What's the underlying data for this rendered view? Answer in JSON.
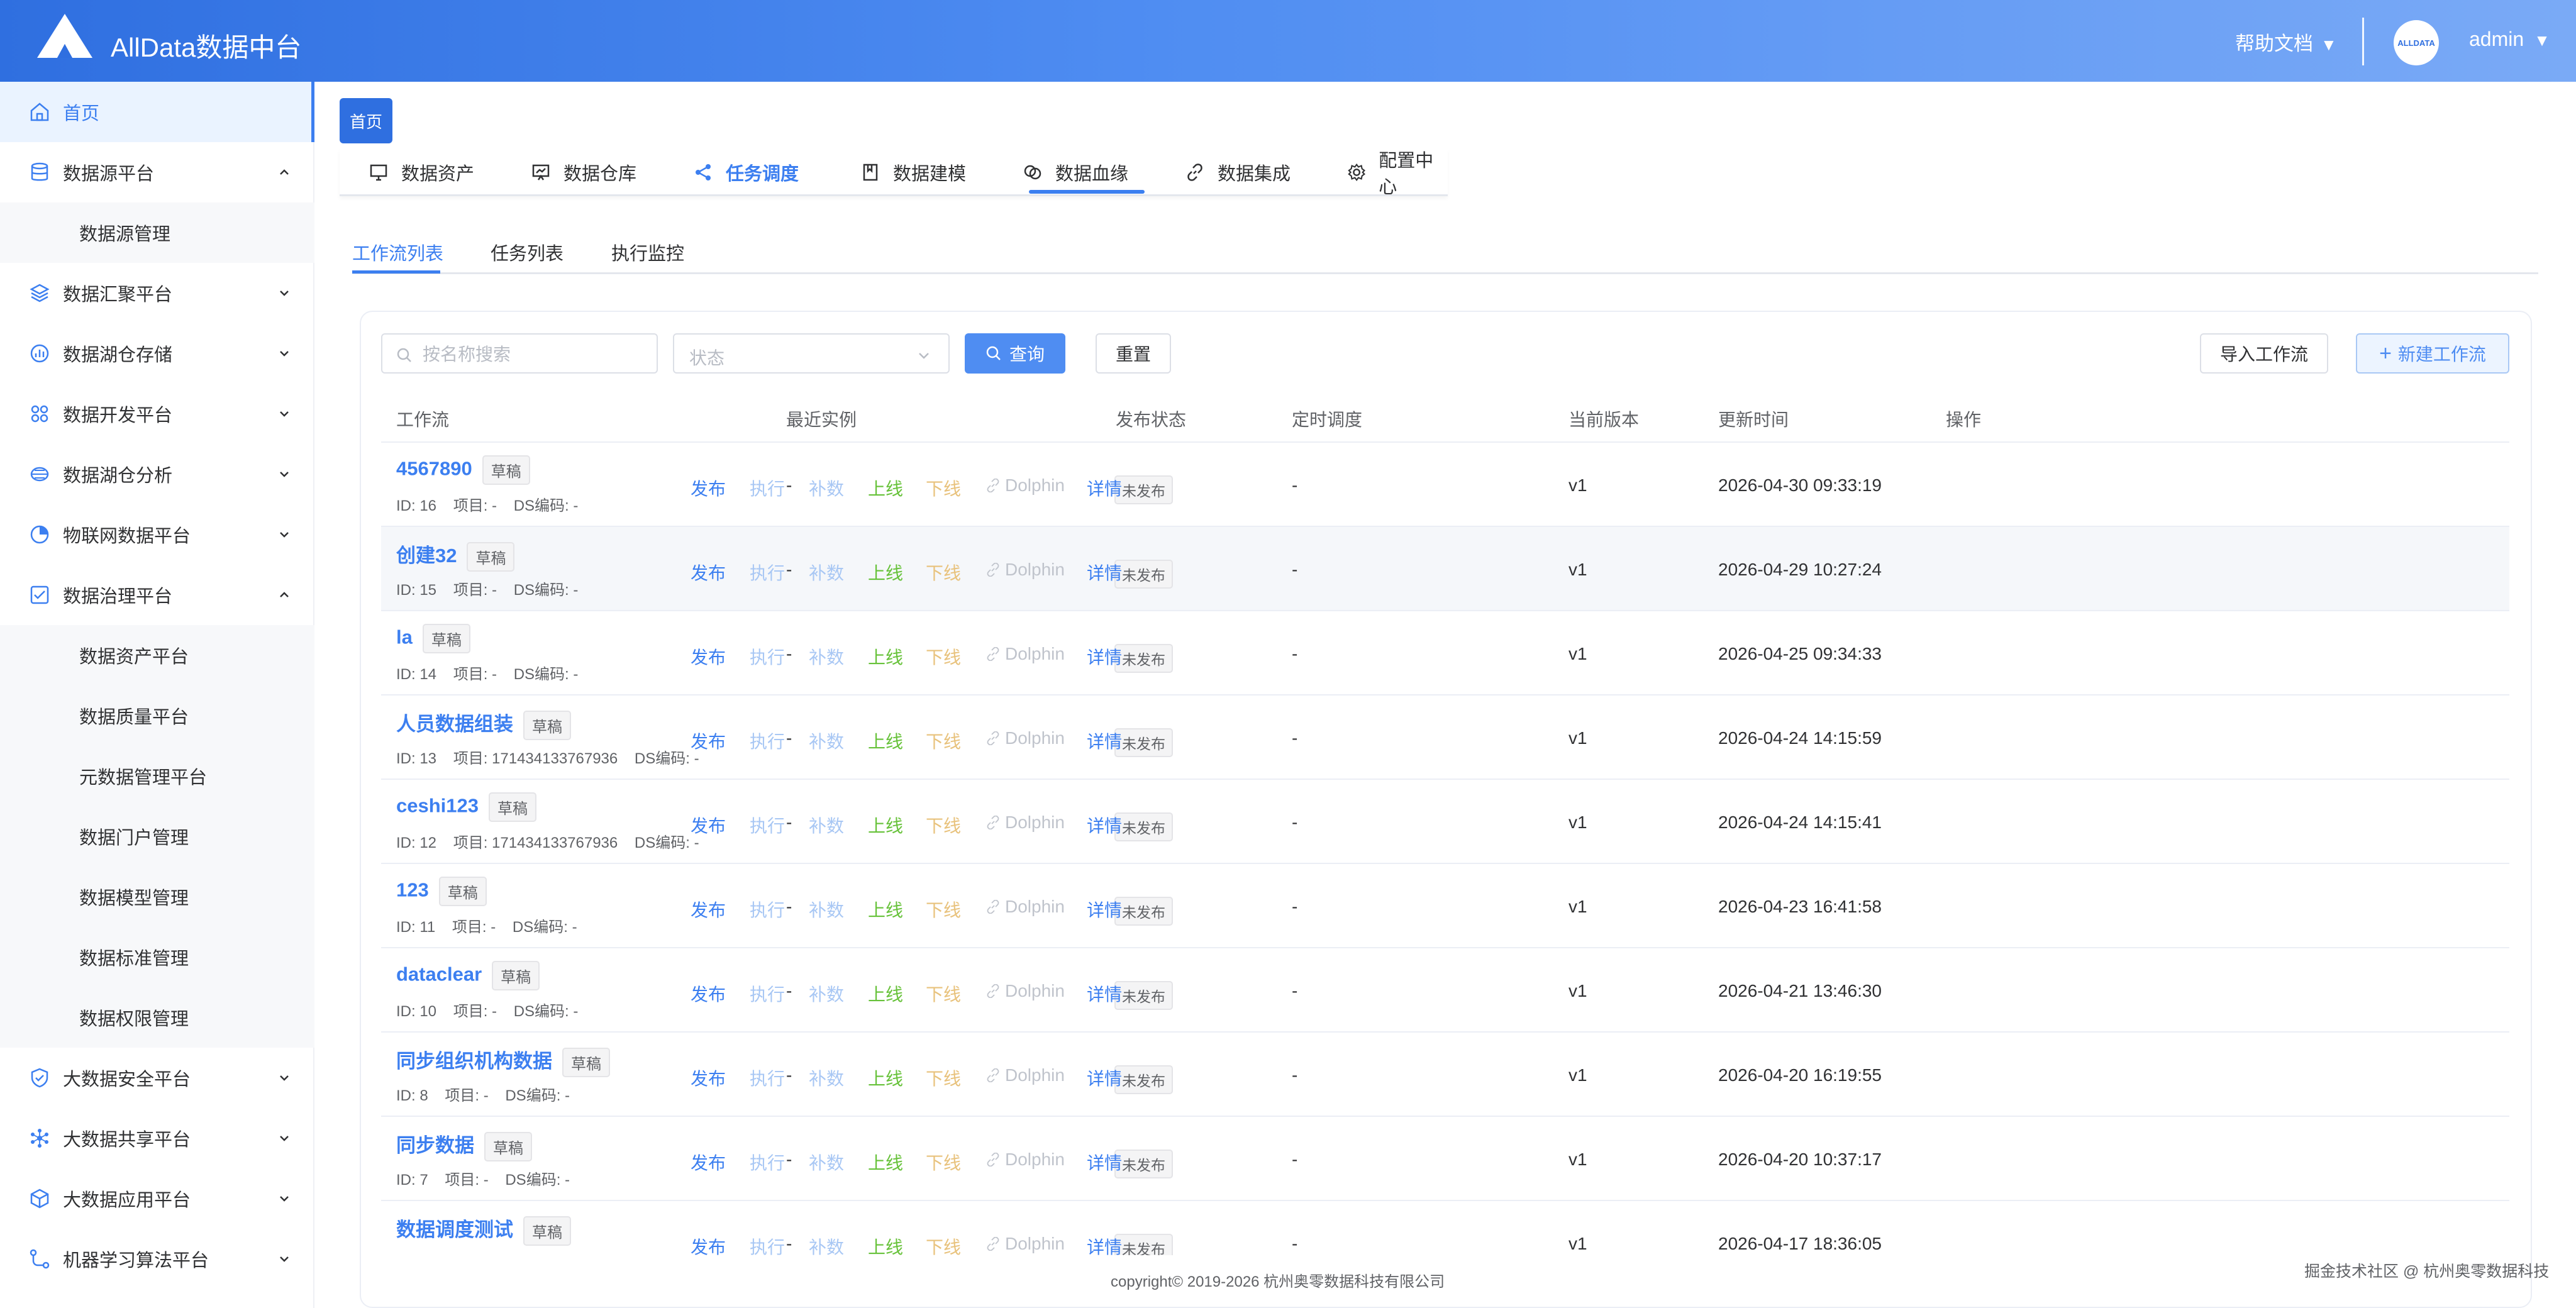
{
  "header": {
    "brand": "AllData数据中台",
    "help": "帮助文档",
    "user": "admin",
    "avatar_text": "ALLDATA",
    "caret": "▼"
  },
  "sidebar": {
    "items": [
      {
        "label": "首页",
        "icon": "home-icon",
        "active": true
      },
      {
        "label": "数据源平台",
        "icon": "database-icon",
        "expanded": true
      },
      {
        "label": "数据源管理",
        "sub": true
      },
      {
        "label": "数据汇聚平台",
        "icon": "layers-icon"
      },
      {
        "label": "数据湖仓存储",
        "icon": "chart-bar-icon"
      },
      {
        "label": "数据开发平台",
        "icon": "grid-icon"
      },
      {
        "label": "数据湖仓分析",
        "icon": "disk-icon"
      },
      {
        "label": "物联网数据平台",
        "icon": "pie-icon"
      },
      {
        "label": "数据治理平台",
        "icon": "checklist-icon",
        "expanded": true
      },
      {
        "label": "数据资产平台",
        "sub": true
      },
      {
        "label": "数据质量平台",
        "sub": true
      },
      {
        "label": "元数据管理平台",
        "sub": true
      },
      {
        "label": "数据门户管理",
        "sub": true
      },
      {
        "label": "数据模型管理",
        "sub": true
      },
      {
        "label": "数据标准管理",
        "sub": true
      },
      {
        "label": "数据权限管理",
        "sub": true
      },
      {
        "label": "大数据安全平台",
        "icon": "shield-icon"
      },
      {
        "label": "大数据共享平台",
        "icon": "share-hub-icon"
      },
      {
        "label": "大数据应用平台",
        "icon": "cube-icon"
      },
      {
        "label": "机器学习算法平台",
        "icon": "flow-icon"
      }
    ]
  },
  "home_tag": "首页",
  "topnav": {
    "items": [
      {
        "label": "数据资产",
        "icon": "monitor-icon"
      },
      {
        "label": "数据仓库",
        "icon": "presentation-icon"
      },
      {
        "label": "任务调度",
        "icon": "share-icon",
        "active": true
      },
      {
        "label": "数据建模",
        "icon": "bookmark-icon"
      },
      {
        "label": "数据血缘",
        "icon": "link-circles-icon"
      },
      {
        "label": "数据集成",
        "icon": "link-icon"
      },
      {
        "label": "配置中心",
        "icon": "gear-icon"
      }
    ]
  },
  "subtabs": {
    "items": [
      {
        "label": "工作流列表",
        "active": true
      },
      {
        "label": "任务列表"
      },
      {
        "label": "执行监控"
      }
    ]
  },
  "toolbar": {
    "search_placeholder": "按名称搜索",
    "status_placeholder": "状态",
    "query_label": "查询",
    "reset_label": "重置",
    "import_label": "导入工作流",
    "new_label": "新建工作流",
    "plus": "+"
  },
  "table": {
    "headers": [
      "工作流",
      "最近实例",
      "发布状态",
      "定时调度",
      "当前版本",
      "更新时间",
      "操作"
    ],
    "ops": [
      "发布",
      "执行",
      "补数",
      "上线",
      "下线",
      "Dolphin",
      "详情"
    ],
    "rows": [
      {
        "name": "4567890",
        "badge": "草稿",
        "meta": "ID: 16    项目: -    DS编码: -",
        "latest": "-",
        "status": "未发布",
        "schedule": "-",
        "version": "v1",
        "updated": "2026-04-30 09:33:19"
      },
      {
        "name": "创建32",
        "badge": "草稿",
        "meta": "ID: 15    项目: -    DS编码: -",
        "latest": "-",
        "status": "未发布",
        "schedule": "-",
        "version": "v1",
        "updated": "2026-04-29 10:27:24"
      },
      {
        "name": "la",
        "badge": "草稿",
        "meta": "ID: 14    项目: -    DS编码: -",
        "latest": "-",
        "status": "未发布",
        "schedule": "-",
        "version": "v1",
        "updated": "2026-04-25 09:34:33"
      },
      {
        "name": "人员数据组装",
        "badge": "草稿",
        "meta": "ID: 13    项目: 171434133767936    DS编码: -",
        "latest": "-",
        "status": "未发布",
        "schedule": "-",
        "version": "v1",
        "updated": "2026-04-24 14:15:59"
      },
      {
        "name": "ceshi123",
        "badge": "草稿",
        "meta": "ID: 12    项目: 171434133767936    DS编码: -",
        "latest": "-",
        "status": "未发布",
        "schedule": "-",
        "version": "v1",
        "updated": "2026-04-24 14:15:41"
      },
      {
        "name": "123",
        "badge": "草稿",
        "meta": "ID: 11    项目: -    DS编码: -",
        "latest": "-",
        "status": "未发布",
        "schedule": "-",
        "version": "v1",
        "updated": "2026-04-23 16:41:58"
      },
      {
        "name": "dataclear",
        "badge": "草稿",
        "meta": "ID: 10    项目: -    DS编码: -",
        "latest": "-",
        "status": "未发布",
        "schedule": "-",
        "version": "v1",
        "updated": "2026-04-21 13:46:30"
      },
      {
        "name": "同步组织机构数据",
        "badge": "草稿",
        "meta": "ID: 8    项目: -    DS编码: -",
        "latest": "-",
        "status": "未发布",
        "schedule": "-",
        "version": "v1",
        "updated": "2026-04-20 16:19:55"
      },
      {
        "name": "同步数据",
        "badge": "草稿",
        "meta": "ID: 7    项目: -    DS编码: -",
        "latest": "-",
        "status": "未发布",
        "schedule": "-",
        "version": "v1",
        "updated": "2026-04-20 10:37:17"
      },
      {
        "name": "数据调度测试",
        "badge": "草稿",
        "meta": "",
        "latest": "-",
        "status": "未发布",
        "schedule": "-",
        "version": "v1",
        "updated": "2026-04-17 18:36:05"
      }
    ]
  },
  "footer": "copyright© 2019-2026 杭州奥零数据科技有限公司",
  "watermark": "掘金技术社区 @ 杭州奥零数据科技"
}
